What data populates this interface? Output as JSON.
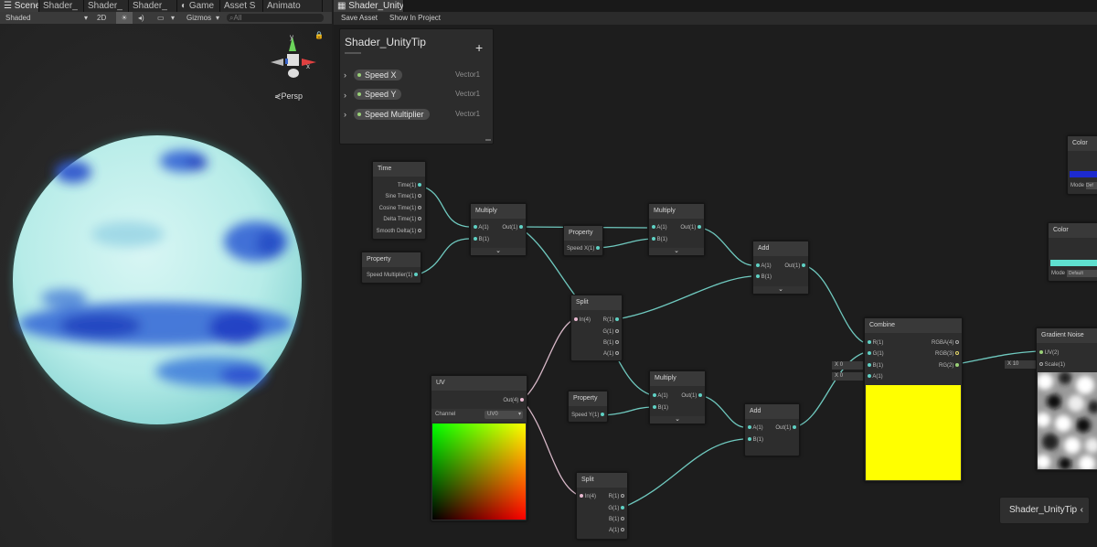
{
  "scene_tabs": [
    "Scene",
    "Shader_",
    "Shader_",
    "Shader_",
    "Game",
    "Asset S",
    "Animato"
  ],
  "scene_toolbar": {
    "shading": "Shaded",
    "mode_2d": "2D",
    "gizmos": "Gizmos",
    "search_placeholder": "All"
  },
  "gizmo": {
    "y_label": "y",
    "x_label": "x",
    "projection": "Persp"
  },
  "graph_tab": "Shader_UnityTi",
  "graph_toolbar": {
    "save": "Save Asset",
    "show": "Show In Project"
  },
  "blackboard": {
    "title": "Shader_UnityTip",
    "add": "+",
    "properties": [
      {
        "name": "Speed X",
        "type": "Vector1"
      },
      {
        "name": "Speed Y",
        "type": "Vector1"
      },
      {
        "name": "Speed Multiplier",
        "type": "Vector1"
      }
    ]
  },
  "nodes": {
    "time": {
      "title": "Time",
      "outputs": [
        "Time(1)",
        "Sine Time(1)",
        "Cosine Time(1)",
        "Delta Time(1)",
        "Smooth Delta(1)"
      ]
    },
    "prop_mult": {
      "title": "Property",
      "out": "Speed Multiplier(1)"
    },
    "multiply1": {
      "title": "Multiply",
      "a": "A(1)",
      "b": "B(1)",
      "out": "Out(1)"
    },
    "prop_x": {
      "title": "Property",
      "out": "Speed X(1)"
    },
    "multiply2": {
      "title": "Multiply",
      "a": "A(1)",
      "b": "B(1)",
      "out": "Out(1)"
    },
    "add1": {
      "title": "Add",
      "a": "A(1)",
      "b": "B(1)",
      "out": "Out(1)"
    },
    "split1": {
      "title": "Split",
      "in": "In(4)",
      "r": "R(1)",
      "g": "G(1)",
      "b": "B(1)",
      "a": "A(1)"
    },
    "uv": {
      "title": "UV",
      "out": "Out(4)",
      "channel_label": "Channel",
      "channel_value": "UV0"
    },
    "prop_y": {
      "title": "Property",
      "out": "Speed Y(1)"
    },
    "multiply3": {
      "title": "Multiply",
      "a": "A(1)",
      "b": "B(1)",
      "out": "Out(1)"
    },
    "add2": {
      "title": "Add",
      "a": "A(1)",
      "b": "B(1)",
      "out": "Out(1)"
    },
    "split2": {
      "title": "Split",
      "in": "In(4)",
      "r": "R(1)",
      "g": "G(1)",
      "b": "B(1)",
      "a": "A(1)"
    },
    "combine": {
      "title": "Combine",
      "r": "R(1)",
      "g": "G(1)",
      "b": "B(1)",
      "a": "A(1)",
      "rgba": "RGBA(4)",
      "rgb": "RGB(3)",
      "rg": "RG(2)",
      "xb": "X",
      "xb_val": "0",
      "xa": "X",
      "xa_val": "0"
    },
    "gradient_noise": {
      "title": "Gradient Noise",
      "uv": "UV(2)",
      "scale": "Scale(1)",
      "x": "X",
      "x_val": "10"
    },
    "color1": {
      "title": "Color",
      "mode_label": "Mode",
      "mode_value": "Def"
    },
    "color2": {
      "title": "Color",
      "mode_label": "Mode",
      "mode_value": "Default"
    }
  },
  "subgraph_badge": "Shader_UnityTip",
  "colors": {
    "wire": "#6fc9bf",
    "uv_wire": "#d9b9c9",
    "combine_preview": "#ffff00",
    "color1_swatch": "#1d2ad0",
    "color2_swatch": "#5fe0cf"
  }
}
